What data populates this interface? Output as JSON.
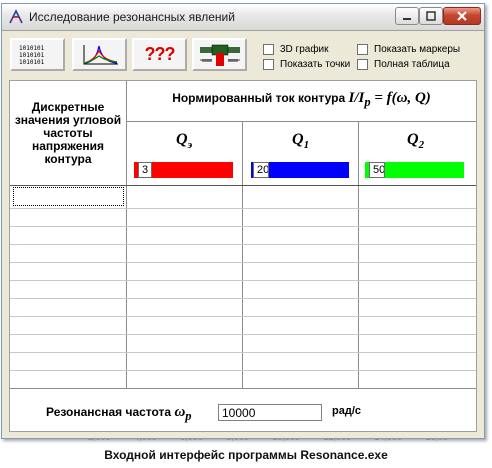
{
  "background": {
    "axis_ticks": [
      "2,000",
      "4,000",
      "6,000",
      "8,000",
      "10,000",
      "12,000",
      "14,000",
      "16,00"
    ]
  },
  "window": {
    "title": "Исследование резонансных явлений",
    "accent_close": "#c7452f"
  },
  "toolbar": {
    "btn_table_icon": "binary-table-icon",
    "btn_graph_icon": "resonance-graph-icon",
    "btn_help_label": "???",
    "btn_circuit_icon": "circuit-icon",
    "options": {
      "graph3d": "3D график",
      "show_points": "Показать точки",
      "show_markers": "Показать маркеры",
      "full_table": "Полная таблица"
    }
  },
  "table": {
    "left_header": "Дискретные значения угловой частоты напряжения контура",
    "main_header_text": "Нормированный ток контура",
    "main_header_formula": "I/I",
    "main_header_sub": "p",
    "main_header_formula_tail": " = f(ω, Q)",
    "columns": [
      {
        "q": "Q",
        "sub": "э",
        "value": "3",
        "color": "#ff0000"
      },
      {
        "q": "Q",
        "sub": "1",
        "value": "20",
        "color": "#0000ff"
      },
      {
        "q": "Q",
        "sub": "2",
        "value": "50",
        "color": "#00ff00"
      }
    ],
    "row_count": 10
  },
  "resonance": {
    "label": "Резонансная частота",
    "omega": "ω",
    "omega_sub": "p",
    "value": "10000",
    "unit": "рад/с"
  },
  "caption": "Входной интерфейс программы Resonance.exe"
}
